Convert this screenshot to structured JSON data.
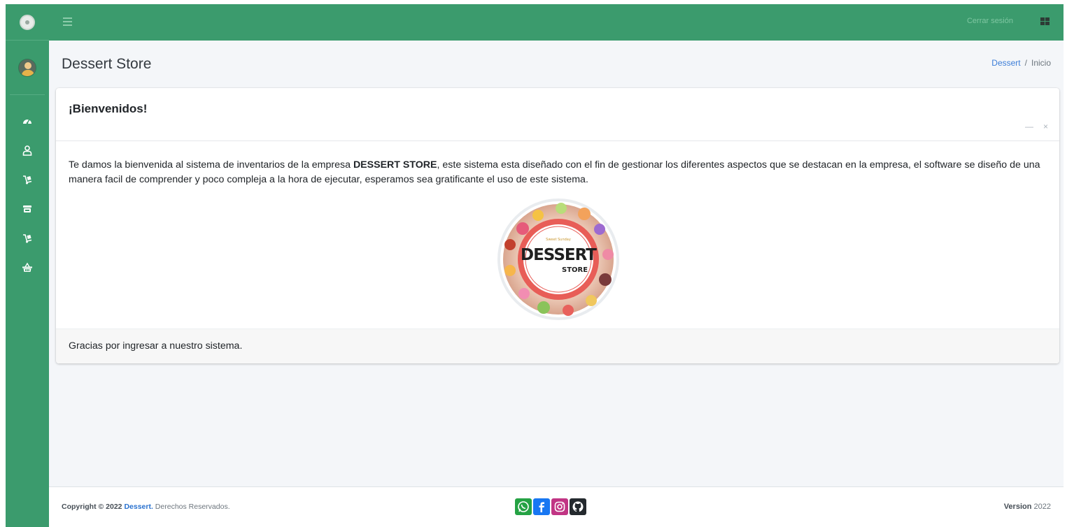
{
  "app": {
    "title": "Dessert Store"
  },
  "sidebar": {
    "items": [
      {
        "icon": "tachometer-icon"
      },
      {
        "icon": "user-icon"
      },
      {
        "icon": "dolly-icon"
      },
      {
        "icon": "store-icon"
      },
      {
        "icon": "dolly-icon"
      },
      {
        "icon": "basket-icon"
      }
    ]
  },
  "topbar": {
    "logout_label": "Cerrar sesión"
  },
  "breadcrumb": {
    "home": "Dessert",
    "separator": "/",
    "current": "Inicio"
  },
  "card": {
    "title": "¡Bienvenidos!",
    "text_before": "Te damos la bienvenida al sistema de inventarios de la empresa ",
    "company": "DESSERT STORE",
    "text_after": ", este sistema esta diseñado con el fin de gestionar los diferentes aspectos que se destacan en la empresa, el software se diseño de una manera facil de comprender y poco compleja a la hora de ejecutar, esperamos sea gratificante el uso de este sistema.",
    "footer_text": "Gracias por ingresar a nuestro sistema.",
    "collapse_icon": "—",
    "close_icon": "×"
  },
  "logo": {
    "small": "Sweet Sunday",
    "big": "DESSERT",
    "sub": "STORE"
  },
  "footer": {
    "copyright_prefix": "Copyright © 2022 ",
    "brand": "Dessert.",
    "rights": " Derechos Reservados.",
    "version_label": "Version",
    "version_value": "2022"
  },
  "colors": {
    "primary": "#3b9b6d",
    "link": "#3b7dd8",
    "logo_red": "#e85d57"
  }
}
